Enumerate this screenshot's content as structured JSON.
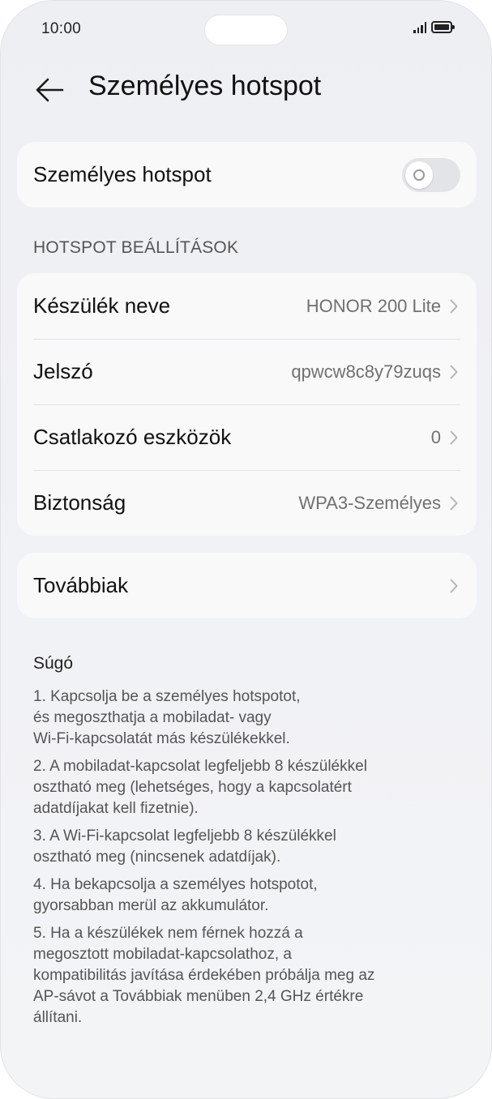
{
  "status_bar": {
    "time": "10:00"
  },
  "header": {
    "title": "Személyes hotspot",
    "back_icon": "arrow-left-icon"
  },
  "hotspot_toggle": {
    "label": "Személyes hotspot",
    "state": "off"
  },
  "settings_section": {
    "header": "HOTSPOT BEÁLLÍTÁSOK",
    "rows": [
      {
        "label": "Készülék neve",
        "value": "HONOR 200 Lite"
      },
      {
        "label": "Jelszó",
        "value": "qpwcw8c8y79zuqs"
      },
      {
        "label": "Csatlakozó eszközök",
        "value": "0"
      },
      {
        "label": "Biztonság",
        "value": "WPA3-Személyes"
      }
    ]
  },
  "more": {
    "label": "Továbbiak"
  },
  "help": {
    "title": "Súgó",
    "items": [
      "1. Kapcsolja be a személyes hotspotot,\nés megoszthatja a mobiladat- vagy\nWi-Fi-kapcsolatát más készülékekkel.",
      "2. A mobiladat-kapcsolat legfeljebb 8 készülékkel\nosztható meg (lehetséges, hogy a kapcsolatért\nadatdíjakat kell fizetnie).",
      "3. A Wi-Fi-kapcsolat legfeljebb 8 készülékkel\nosztható meg (nincsenek adatdíjak).",
      "4. Ha bekapcsolja a személyes hotspotot,\ngyorsabban merül az akkumulátor.",
      "5. Ha a készülékek nem férnek hozzá a\nmegosztott mobiladat-kapcsolathoz, a\nkompatibilitás javítása érdekében próbálja meg az\nAP-sávot a Továbbiak menüben 2,4 GHz értékre\nállítani."
    ]
  },
  "colors": {
    "background": "#eeeff3",
    "card": "#f9f9fa",
    "secondary_text": "#707070"
  }
}
